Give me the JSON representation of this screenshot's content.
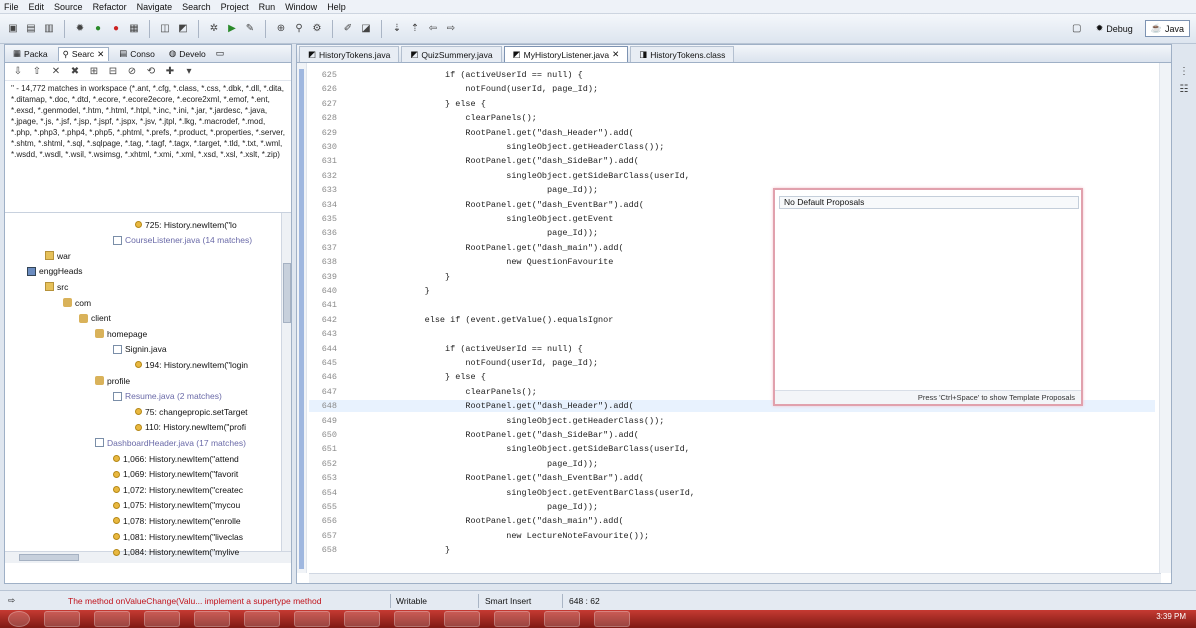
{
  "menu": [
    "File",
    "Edit",
    "Source",
    "Refactor",
    "Navigate",
    "Search",
    "Project",
    "Run",
    "Window",
    "Help"
  ],
  "perspectives": {
    "debug": "Debug",
    "java": "Java"
  },
  "left_tabs": [
    {
      "label": "Packa",
      "icon": "package-icon",
      "active": false
    },
    {
      "label": "Searc",
      "icon": "search-icon",
      "active": true
    },
    {
      "label": "Conso",
      "icon": "console-icon",
      "active": false
    },
    {
      "label": "Develo",
      "icon": "globe-icon",
      "active": false
    }
  ],
  "search_summary": "'' - 14,772 matches in workspace (*.ant, *.cfg, *.class, *.css, *.dbk, *.dll, *.dita, *.ditamap, *.doc, *.dtd, *.ecore, *.ecore2ecore, *.ecore2xml, *.emof, *.ent, *.exsd, *.genmodel, *.htm, *.html, *.htpl, *.inc, *.ini, *.jar, *.jardesc, *.java, *.jpage, *.js, *.jsf, *.jsp, *.jspf, *.jspx, *.jsv, *.jtpl, *.lkg, *.macrodef, *.mod, *.php, *.php3, *.php4, *.php5, *.phtml, *.prefs, *.product, *.properties, *.server, *.shtm, *.shtml, *.sql, *.sqlpage, *.tag, *.tagf, *.tagx, *.target, *.tld, *.txt, *.wml, *.wsdd, *.wsdl, *.wsil, *.wsimsg, *.xhtml, *.xmi, *.xml, *.xsd, *.xsl, *.xslt, *.zip)",
  "tree": [
    {
      "text": "725: History.newItem(\"lo",
      "icon": "dot",
      "indent": 130,
      "match": false
    },
    {
      "text": "CourseListener.java (14 matches)",
      "icon": "file",
      "indent": 108,
      "match": true
    },
    {
      "text": "war",
      "icon": "folder",
      "indent": 40,
      "match": false
    },
    {
      "text": "enggHeads",
      "icon": "proj",
      "indent": 22,
      "match": false
    },
    {
      "text": "src",
      "icon": "folder",
      "indent": 40,
      "match": false
    },
    {
      "text": "com",
      "icon": "pkg",
      "indent": 58,
      "match": false
    },
    {
      "text": "client",
      "icon": "pkg",
      "indent": 74,
      "match": false
    },
    {
      "text": "homepage",
      "icon": "pkg",
      "indent": 90,
      "match": false
    },
    {
      "text": "Signin.java",
      "icon": "file",
      "indent": 108,
      "match": false
    },
    {
      "text": "194: History.newItem(\"login",
      "icon": "dot",
      "indent": 130,
      "match": false
    },
    {
      "text": "profile",
      "icon": "pkg",
      "indent": 90,
      "match": false
    },
    {
      "text": "Resume.java (2 matches)",
      "icon": "file",
      "indent": 108,
      "match": true
    },
    {
      "text": "75: changepropic.setTarget",
      "icon": "dot",
      "indent": 130,
      "match": false
    },
    {
      "text": "110: History.newItem(\"profi",
      "icon": "dot",
      "indent": 130,
      "match": false
    },
    {
      "text": "DashboardHeader.java (17 matches)",
      "icon": "file",
      "indent": 90,
      "match": true
    },
    {
      "text": "1,066: History.newItem(\"attend",
      "icon": "dot",
      "indent": 108,
      "match": false
    },
    {
      "text": "1,069: History.newItem(\"favorit",
      "icon": "dot",
      "indent": 108,
      "match": false
    },
    {
      "text": "1,072: History.newItem(\"createc",
      "icon": "dot",
      "indent": 108,
      "match": false
    },
    {
      "text": "1,075: History.newItem(\"mycou",
      "icon": "dot",
      "indent": 108,
      "match": false
    },
    {
      "text": "1,078: History.newItem(\"enrolle",
      "icon": "dot",
      "indent": 108,
      "match": false
    },
    {
      "text": "1,081: History.newItem(\"liveclas",
      "icon": "dot",
      "indent": 108,
      "match": false
    },
    {
      "text": "1,084: History.newItem(\"mylive",
      "icon": "dot",
      "indent": 108,
      "match": false
    }
  ],
  "editor_tabs": [
    {
      "label": "HistoryTokens.java",
      "active": false
    },
    {
      "label": "QuizSummery.java",
      "active": false
    },
    {
      "label": "MyHistoryListener.java",
      "active": true
    },
    {
      "label": "HistoryTokens.class",
      "active": false
    }
  ],
  "code_lines": [
    {
      "n": "625",
      "code": "                    if (activeUserId == null) {"
    },
    {
      "n": "626",
      "code": "                        notFound(userId, page_Id);"
    },
    {
      "n": "627",
      "code": "                    } else {"
    },
    {
      "n": "628",
      "code": "                        clearPanels();"
    },
    {
      "n": "629",
      "code": "                        RootPanel.get(\"dash_Header\").add("
    },
    {
      "n": "630",
      "code": "                                singleObject.getHeaderClass());"
    },
    {
      "n": "631",
      "code": "                        RootPanel.get(\"dash_SideBar\").add("
    },
    {
      "n": "632",
      "code": "                                singleObject.getSideBarClass(userId,"
    },
    {
      "n": "633",
      "code": "                                        page_Id));"
    },
    {
      "n": "634",
      "code": "                        RootPanel.get(\"dash_EventBar\").add("
    },
    {
      "n": "635",
      "code": "                                singleObject.getEvent"
    },
    {
      "n": "636",
      "code": "                                        page_Id));"
    },
    {
      "n": "637",
      "code": "                        RootPanel.get(\"dash_main\").add("
    },
    {
      "n": "638",
      "code": "                                new QuestionFavourite"
    },
    {
      "n": "639",
      "code": "                    }"
    },
    {
      "n": "640",
      "code": "                }"
    },
    {
      "n": "641",
      "code": ""
    },
    {
      "n": "642",
      "code": "                else if (event.getValue().equalsIgnor"
    },
    {
      "n": "643",
      "code": ""
    },
    {
      "n": "644",
      "code": "                    if (activeUserId == null) {"
    },
    {
      "n": "645",
      "code": "                        notFound(userId, page_Id);"
    },
    {
      "n": "646",
      "code": "                    } else {"
    },
    {
      "n": "647",
      "code": "                        clearPanels();"
    },
    {
      "n": "648",
      "code": "                        RootPanel.get(\"dash_Header\").add("
    },
    {
      "n": "649",
      "code": "                                singleObject.getHeaderClass());"
    },
    {
      "n": "650",
      "code": "                        RootPanel.get(\"dash_SideBar\").add("
    },
    {
      "n": "651",
      "code": "                                singleObject.getSideBarClass(userId,"
    },
    {
      "n": "652",
      "code": "                                        page_Id));"
    },
    {
      "n": "653",
      "code": "                        RootPanel.get(\"dash_EventBar\").add("
    },
    {
      "n": "654",
      "code": "                                singleObject.getEventBarClass(userId,"
    },
    {
      "n": "655",
      "code": "                                        page_Id));"
    },
    {
      "n": "656",
      "code": "                        RootPanel.get(\"dash_main\").add("
    },
    {
      "n": "657",
      "code": "                                new LectureNoteFavourite());"
    },
    {
      "n": "658",
      "code": "                    }"
    }
  ],
  "current_line": "648",
  "popup": {
    "item": "No Default Proposals",
    "footer": "Press 'Ctrl+Space' to show Template Proposals"
  },
  "status": {
    "message": "The method onValueChange(Valu... implement a supertype method",
    "writable": "Writable",
    "insert_mode": "Smart Insert",
    "position": "648 : 62"
  },
  "clock": "3:39 PM"
}
